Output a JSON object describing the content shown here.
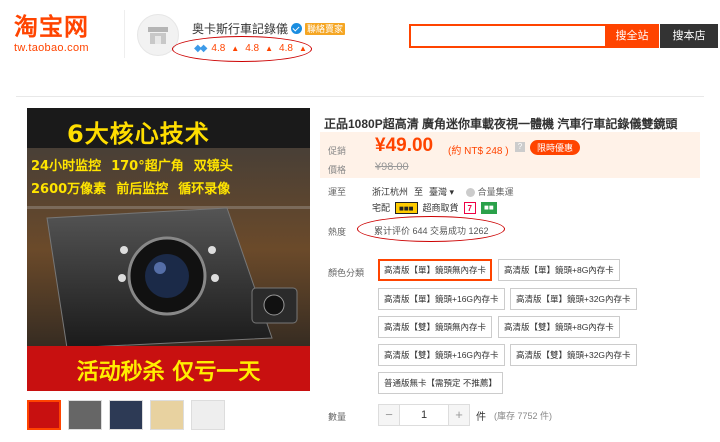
{
  "header": {
    "logo_text": "淘宝网",
    "logo_url": "tw.taobao.com",
    "shop_name": "奥卡斯行車記錄儀",
    "shop_badge": "聯絡賣家",
    "ratings": [
      "4.8",
      "4.8",
      "4.8"
    ],
    "search_value": "",
    "search_all_label": "搜全站",
    "search_shop_label": "搜本店"
  },
  "gallery": {
    "headline": "6大核心技术",
    "features": [
      "24小时监控",
      "170°超广角",
      "双镜头",
      "2600万像素",
      "前后监控",
      "循环录像"
    ],
    "banner": "活动秒杀 仅亏一天",
    "thumbnail_count": 5
  },
  "product": {
    "title": "正品1080P超高清 廣角迷你車載夜視一體機 汽車行車記錄儀雙鏡頭",
    "price_label": "促銷",
    "price": "¥49.00",
    "price_ntd": "(約 NT$ 248 )",
    "help_icon": "?",
    "promo_badge": "限時優惠",
    "price_orig_label": "價格",
    "price_orig": "¥98.00",
    "shipping_label": "運至",
    "ship_from": "浙江杭州",
    "ship_to_prefix": "至",
    "ship_to": "臺灣",
    "consolidation": "合量集運",
    "methods": [
      "宅配",
      "超商取貨"
    ],
    "popularity_label": "熱度",
    "sales_text": "累计评价 644   交易成功 1262",
    "options_label": "顏色分類",
    "options": [
      "高清版【單】鏡頭無內存卡",
      "高清版【單】鏡頭+8G內存卡",
      "高清版【單】鏡頭+16G內存卡",
      "高清版【單】鏡頭+32G內存卡",
      "高清版【雙】鏡頭無內存卡",
      "高清版【雙】鏡頭+8G內存卡",
      "高清版【雙】鏡頭+16G內存卡",
      "高清版【雙】鏡頭+32G內存卡",
      "普通版無卡【需預定 不推薦】"
    ],
    "selected_option_index": 0,
    "quantity_label": "數量",
    "quantity": "1",
    "quantity_unit": "件",
    "stock": "(庫存 7752 件)"
  },
  "colors": {
    "brand": "#ff4400",
    "annotation_circle": "#cc0000"
  }
}
